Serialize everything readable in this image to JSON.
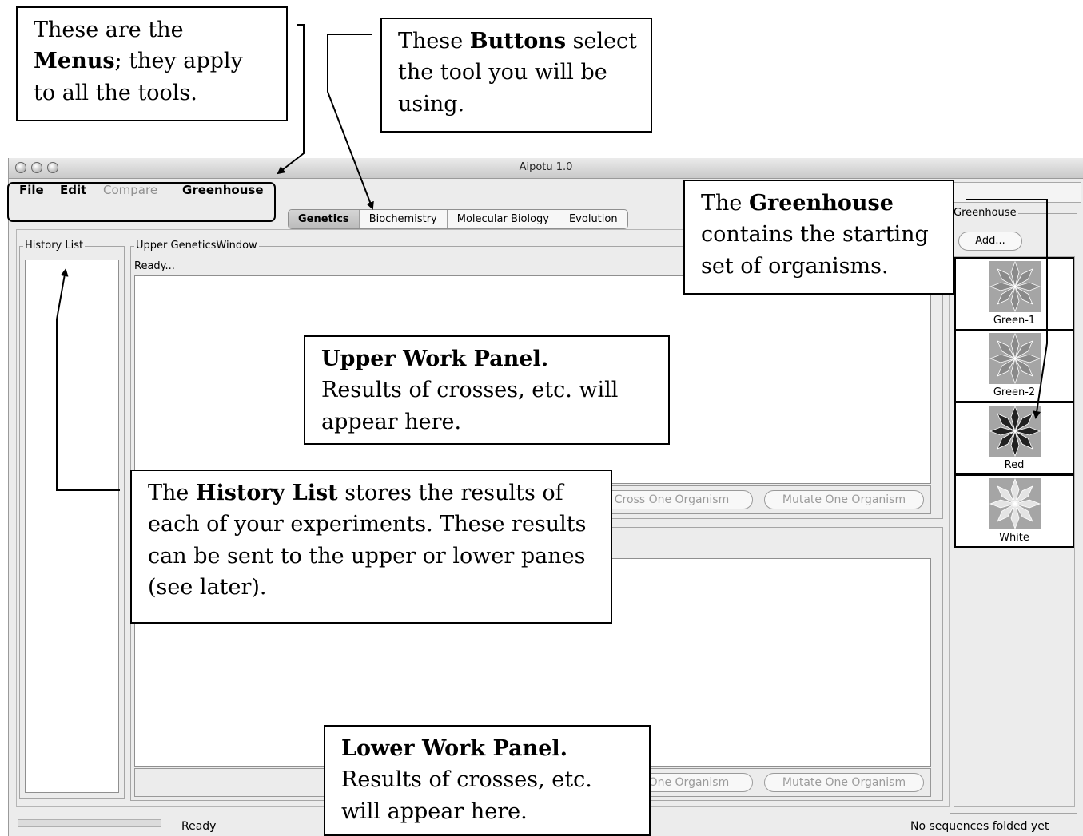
{
  "window": {
    "title": "Aipotu 1.0"
  },
  "menus": [
    {
      "label": "File",
      "enabled": true
    },
    {
      "label": "Edit",
      "enabled": true
    },
    {
      "label": "Compare",
      "enabled": false
    },
    {
      "label": "Greenhouse",
      "enabled": true
    }
  ],
  "tabs": [
    {
      "label": "Genetics",
      "active": true
    },
    {
      "label": "Biochemistry",
      "active": false
    },
    {
      "label": "Molecular Biology",
      "active": false
    },
    {
      "label": "Evolution",
      "active": false
    }
  ],
  "history": {
    "legend": "History List"
  },
  "upper": {
    "legend": "Upper GeneticsWindow",
    "status": "Ready...",
    "cross_button": "Cross One Organism",
    "mutate_button": "Mutate One Organism"
  },
  "lower": {
    "cross_button": "Cross One Organism",
    "mutate_button": "Mutate One Organism"
  },
  "greenhouse": {
    "legend": "Greenhouse",
    "add_button": "Add...",
    "organisms": [
      {
        "name": "Green-1",
        "color": "#8a8a8a"
      },
      {
        "name": "Green-2",
        "color": "#8a8a8a"
      },
      {
        "name": "Red",
        "color": "#222222"
      },
      {
        "name": "White",
        "color": "#e4e4e4"
      }
    ]
  },
  "statusbar": {
    "left": "Ready",
    "right": "No sequences folded yet"
  },
  "annotations": {
    "menus": {
      "l1": "These are the",
      "bold": "Menus",
      "rest": "; they apply",
      "l3": "to all the tools."
    },
    "buttons": {
      "pre": "These ",
      "bold": "Buttons",
      "post": " select",
      "l2": "the tool you will be",
      "l3": "using."
    },
    "greenhouse": {
      "pre": "The ",
      "bold": "Greenhouse",
      "l2": "contains the starting",
      "l3": "set of organisms."
    },
    "upper": {
      "title": "Upper Work Panel.",
      "l2": "Results of crosses, etc. will",
      "l3": "appear here."
    },
    "history": {
      "pre": "The ",
      "bold": "History List",
      "post": " stores the results of",
      "l2": "each of your experiments. These results",
      "l3": "can be sent to the upper or lower panes",
      "l4": "(see later)."
    },
    "lower": {
      "title": "Lower Work Panel.",
      "l2": "Results of crosses, etc.",
      "l3": "will appear here."
    }
  }
}
